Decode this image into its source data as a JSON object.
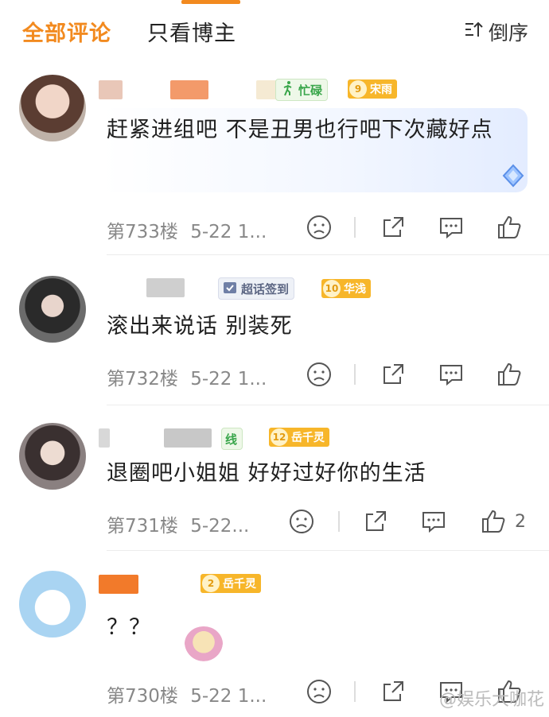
{
  "header": {
    "tab_all": "全部评论",
    "tab_author": "只看博主",
    "sort_label": "倒序",
    "accent": "#f28a1f"
  },
  "comments": [
    {
      "text": "赶紧进组吧 不是丑男也行吧下次藏好点",
      "floor": "第733楼",
      "time": "5-22 1...",
      "badge_text": "忙碌",
      "level_num": "9",
      "level_name": "宋雨",
      "likes": ""
    },
    {
      "text": "滚出来说话 别装死",
      "floor": "第732楼",
      "time": "5-22 1...",
      "badge_text": "超话签到",
      "level_num": "10",
      "level_name": "华浅",
      "likes": ""
    },
    {
      "text": "退圈吧小姐姐 好好过好你的生活",
      "floor": "第731楼",
      "time": "5-22...",
      "badge_text": "线",
      "level_num": "12",
      "level_name": "岳千灵",
      "likes": "2"
    },
    {
      "text": "？？",
      "floor": "第730楼",
      "time": "5-22 1...",
      "badge_text": "",
      "level_num": "2",
      "level_name": "岳千灵",
      "likes": ""
    }
  ],
  "icons": {
    "sort": "sort-icon",
    "dislike": "sad-face-icon",
    "share": "share-icon",
    "comment": "comment-icon",
    "like": "thumbs-up-icon"
  },
  "watermark": "@娱乐大咖花"
}
